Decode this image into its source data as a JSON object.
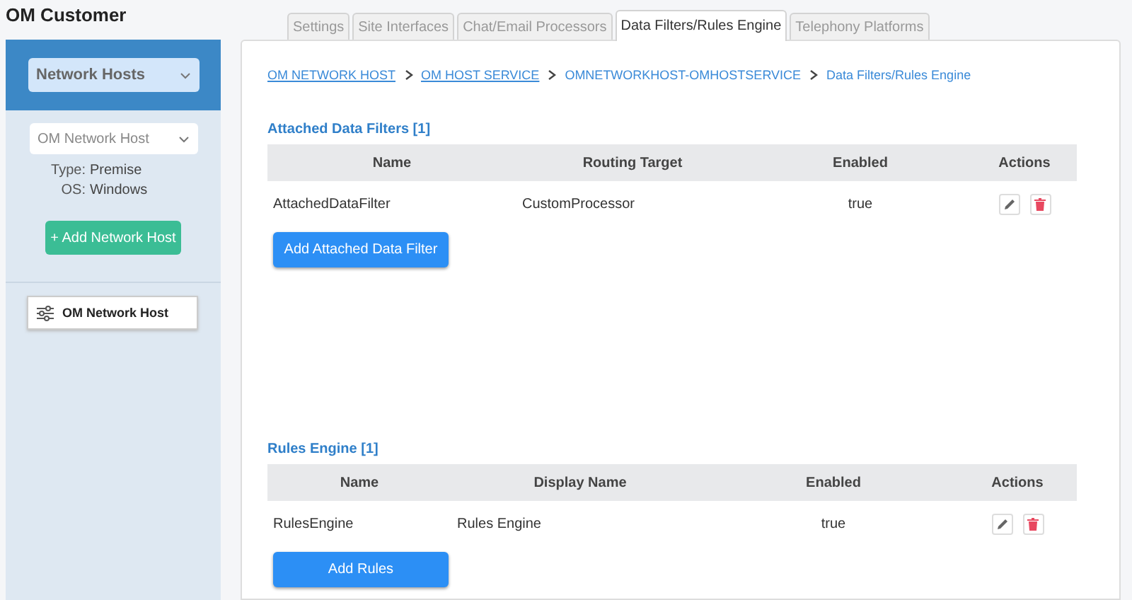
{
  "customer_title": "OM Customer",
  "sidebar": {
    "category_select": {
      "value": "Network Hosts"
    },
    "host_select": {
      "value": "OM Network Host"
    },
    "details": [
      {
        "label": "Type:",
        "value": "Premise"
      },
      {
        "label": "OS:",
        "value": "Windows"
      }
    ],
    "add_button": "+ Add Network Host",
    "items": [
      {
        "label": "OM Network Host",
        "selected": true
      }
    ]
  },
  "tabs": [
    {
      "label": "Settings",
      "selected": false
    },
    {
      "label": "Site Interfaces",
      "selected": false
    },
    {
      "label": "Chat/Email Processors",
      "selected": false
    },
    {
      "label": "Data Filters/Rules Engine",
      "selected": true
    },
    {
      "label": "Telephony Platforms",
      "selected": false
    }
  ],
  "breadcrumb": [
    {
      "label": "OM NETWORK HOST",
      "kind": "link"
    },
    {
      "label": "OM HOST SERVICE",
      "kind": "link"
    },
    {
      "label": "OMNETWORKHOST-OMHOSTSERVICE",
      "kind": "crumb"
    },
    {
      "label": "Data Filters/Rules Engine",
      "kind": "crumb"
    }
  ],
  "sections": [
    {
      "title": "Attached Data Filters [1]",
      "columns": [
        "Name",
        "Routing Target",
        "Enabled",
        "Actions"
      ],
      "rows": [
        [
          "AttachedDataFilter",
          "CustomProcessor",
          "true"
        ]
      ],
      "add_button": "Add Attached Data Filter"
    },
    {
      "title": "Rules Engine [1]",
      "columns": [
        "Name",
        "Display Name",
        "Enabled",
        "Actions"
      ],
      "rows": [
        [
          "RulesEngine",
          "Rules Engine",
          "true"
        ]
      ],
      "add_button": "Add Rules"
    }
  ]
}
